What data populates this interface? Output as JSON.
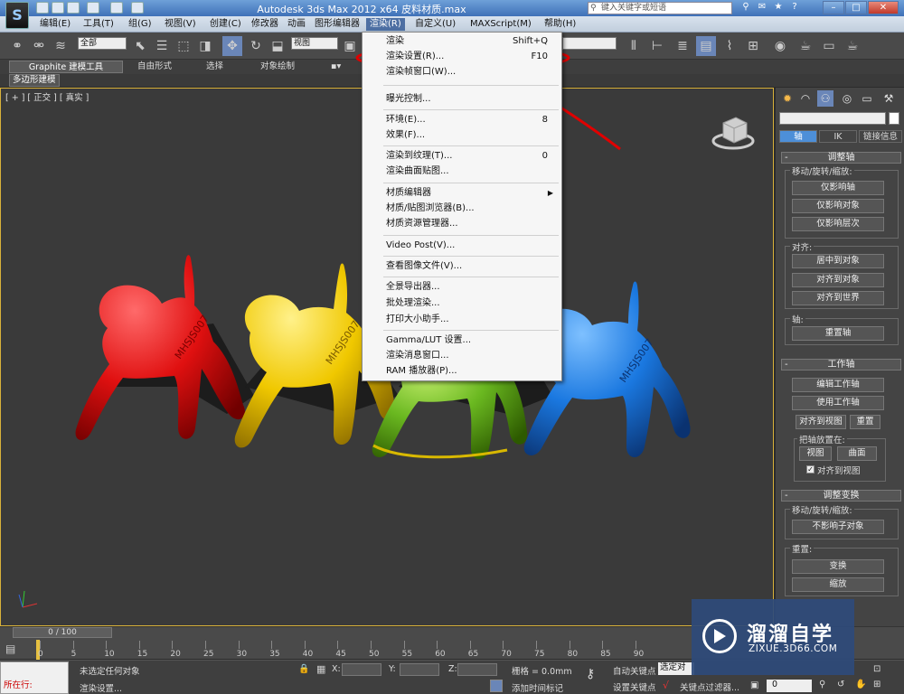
{
  "window": {
    "title": "Autodesk 3ds Max  2012 x64      皮料材质.max",
    "search_placeholder": "键入关键字或短语",
    "logo_letter": "S"
  },
  "menubar": {
    "items": [
      "编辑(E)",
      "工具(T)",
      "组(G)",
      "视图(V)",
      "创建(C)",
      "修改器",
      "动画",
      "图形编辑器",
      "渲染(R)",
      "自定义(U)",
      "MAXScript(M)",
      "帮助(H)"
    ]
  },
  "toolbar": {
    "selection_filter": "全部",
    "ref_coord": "视图"
  },
  "ribbon": {
    "tabs": [
      "Graphite 建模工具",
      "自由形式",
      "选择",
      "对象绘制"
    ],
    "sub_tab": "多边形建模"
  },
  "viewport": {
    "label": "[ + ] [ 正交 ] [ 真实 ]",
    "watermark_text": "MHSJS007"
  },
  "render_menu": {
    "items": [
      {
        "label": "渲染",
        "shortcut": "Shift+Q"
      },
      {
        "label": "渲染设置(R)...",
        "shortcut": "F10"
      },
      {
        "label": "渲染帧窗口(W)...",
        "shortcut": ""
      },
      {
        "label": "曝光控制...",
        "shortcut": ""
      },
      {
        "label": "环境(E)...",
        "shortcut": "8"
      },
      {
        "label": "效果(F)...",
        "shortcut": ""
      },
      {
        "label": "渲染到纹理(T)...",
        "shortcut": "0"
      },
      {
        "label": "渲染曲面贴图...",
        "shortcut": ""
      },
      {
        "label": "材质编辑器",
        "shortcut": ""
      },
      {
        "label": "材质/贴图浏览器(B)...",
        "shortcut": ""
      },
      {
        "label": "材质资源管理器...",
        "shortcut": ""
      },
      {
        "label": "Video Post(V)...",
        "shortcut": ""
      },
      {
        "label": "查看图像文件(V)...",
        "shortcut": ""
      },
      {
        "label": "全景导出器...",
        "shortcut": ""
      },
      {
        "label": "批处理渲染...",
        "shortcut": ""
      },
      {
        "label": "打印大小助手...",
        "shortcut": ""
      },
      {
        "label": "Gamma/LUT 设置...",
        "shortcut": ""
      },
      {
        "label": "渲染消息窗口...",
        "shortcut": ""
      },
      {
        "label": "RAM 播放器(P)...",
        "shortcut": ""
      }
    ]
  },
  "command_panel": {
    "tabs": [
      "轴",
      "IK",
      "链接信息"
    ],
    "rollout_adjust_pivot": {
      "title": "调整轴",
      "group_move": "移动/旋转/缩放:",
      "btn_pivot_only": "仅影响轴",
      "btn_object_only": "仅影响对象",
      "btn_hierarchy_only": "仅影响层次",
      "group_align": "对齐:",
      "btn_center_to_object": "居中到对象",
      "btn_align_to_object": "对齐到对象",
      "btn_align_to_world": "对齐到世界",
      "group_pivot": "轴:",
      "btn_reset_pivot": "重置轴"
    },
    "rollout_working_pivot": {
      "title": "工作轴",
      "btn_edit_working": "编辑工作轴",
      "btn_use_working": "使用工作轴",
      "btn_align_to_view": "对齐到视图",
      "btn_reset": "重置",
      "group_place": "把轴放置在:",
      "btn_view": "视图",
      "btn_surface": "曲面",
      "chk_align_view": "对齐到视图"
    },
    "rollout_adjust_transform": {
      "title": "调整变换",
      "group_move": "移动/旋转/缩放:",
      "btn_dont_affect_children": "不影响子对象",
      "group_reset": "重置:",
      "btn_transform": "变换",
      "btn_scale": "缩放"
    }
  },
  "timeline": {
    "slider": "0 / 100",
    "ticks": [
      "0",
      "5",
      "10",
      "15",
      "20",
      "25",
      "30",
      "35",
      "40",
      "45",
      "50",
      "55",
      "60",
      "65",
      "70",
      "75",
      "80",
      "85",
      "90"
    ]
  },
  "status": {
    "maxscript_label": "所在行:",
    "selection_text": "未选定任何对象",
    "prompt_text": "渲染设置...",
    "x_label": "X:",
    "y_label": "Y:",
    "z_label": "Z:",
    "grid": "栅格 = 0.0mm",
    "add_time_tag": "添加时间标记",
    "auto_key": "自动关键点",
    "selected": "选定对",
    "set_key": "设置关键点",
    "key_filters": "关键点过滤器...",
    "current_frame": "0"
  },
  "watermark": {
    "title": "溜溜自学",
    "url": "ZIXUE.3D66.COM"
  },
  "colors": {
    "dog_red": "#e01010",
    "dog_yellow": "#f0c800",
    "dog_green": "#6ab820",
    "dog_blue": "#1a78e0",
    "annotation_red": "#e00000",
    "menu_highlight": "#4d6fa3"
  }
}
